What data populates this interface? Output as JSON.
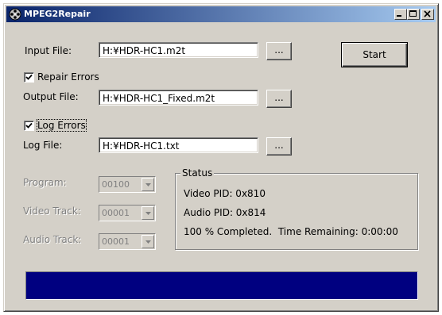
{
  "window": {
    "title": "MPEG2Repair",
    "icon": "film-reel-icon"
  },
  "form": {
    "input_file_label": "Input File:",
    "input_file_value": "H:¥HDR-HC1.m2t",
    "browse_label": "...",
    "start_label": "Start",
    "repair_errors_label": "Repair Errors",
    "repair_errors_checked": true,
    "output_file_label": "Output File:",
    "output_file_value": "H:¥HDR-HC1_Fixed.m2t",
    "log_errors_label": "Log Errors",
    "log_errors_checked": true,
    "log_file_label": "Log File:",
    "log_file_value": "H:¥HDR-HC1.txt",
    "program_label": "Program:",
    "program_value": "00100",
    "video_track_label": "Video Track:",
    "video_track_value": "00001",
    "audio_track_label": "Audio Track:",
    "audio_track_value": "00001"
  },
  "status": {
    "group_label": "Status",
    "video_pid": "Video PID: 0x810",
    "audio_pid": "Audio PID: 0x814",
    "progress_text": "100 % Completed.  Time Remaining: 0:00:00"
  },
  "progress": {
    "percent": 100
  },
  "colors": {
    "titlebar_start": "#0a246a",
    "titlebar_end": "#a6caf0",
    "progress_fill": "#000080",
    "face": "#d4d0c8"
  }
}
